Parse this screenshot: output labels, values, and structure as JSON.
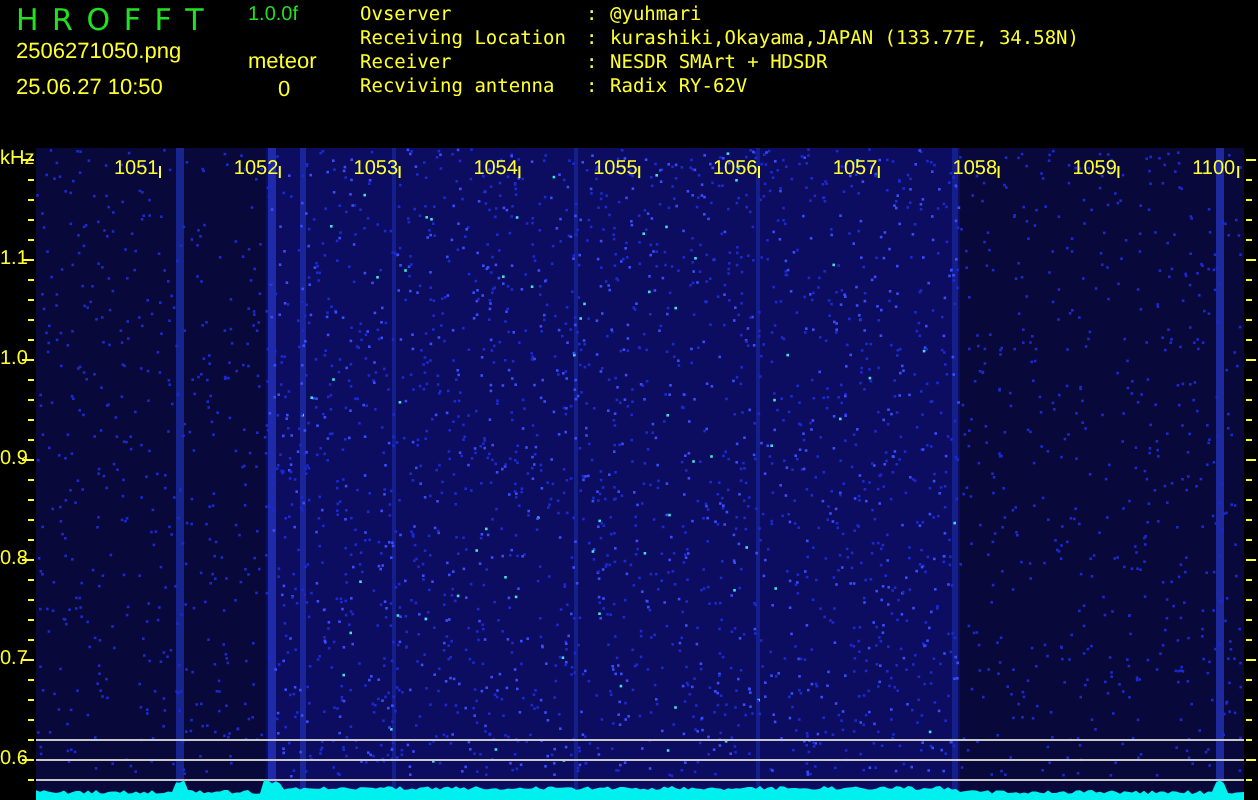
{
  "app": {
    "title": "H R O F F T",
    "version": "1.0.0f"
  },
  "file": {
    "name": "2506271050.png",
    "datetime": "25.06.27 10:50"
  },
  "meteor": {
    "label": "meteor",
    "count": "0"
  },
  "info": [
    {
      "label": "Ovserver",
      "separator": ":",
      "value": "@yuhmari"
    },
    {
      "label": "Receiving Location",
      "separator": ":",
      "value": "kurashiki,Okayama,JAPAN (133.77E, 34.58N)"
    },
    {
      "label": "Receiver",
      "separator": ":",
      "value": "NESDR SMArt + HDSDR"
    },
    {
      "label": "Recviving antenna",
      "separator": ":",
      "value": "Radix RY-62V"
    }
  ],
  "spectrogram": {
    "unit": "kHz",
    "x_labels": [
      "1051",
      "1052",
      "1053",
      "1054",
      "1055",
      "1056",
      "1057",
      "1058",
      "1059",
      "1100"
    ],
    "y_labels": [
      "1.1",
      "1.0",
      "0.9",
      "0.8",
      "0.7",
      "0.6"
    ]
  }
}
